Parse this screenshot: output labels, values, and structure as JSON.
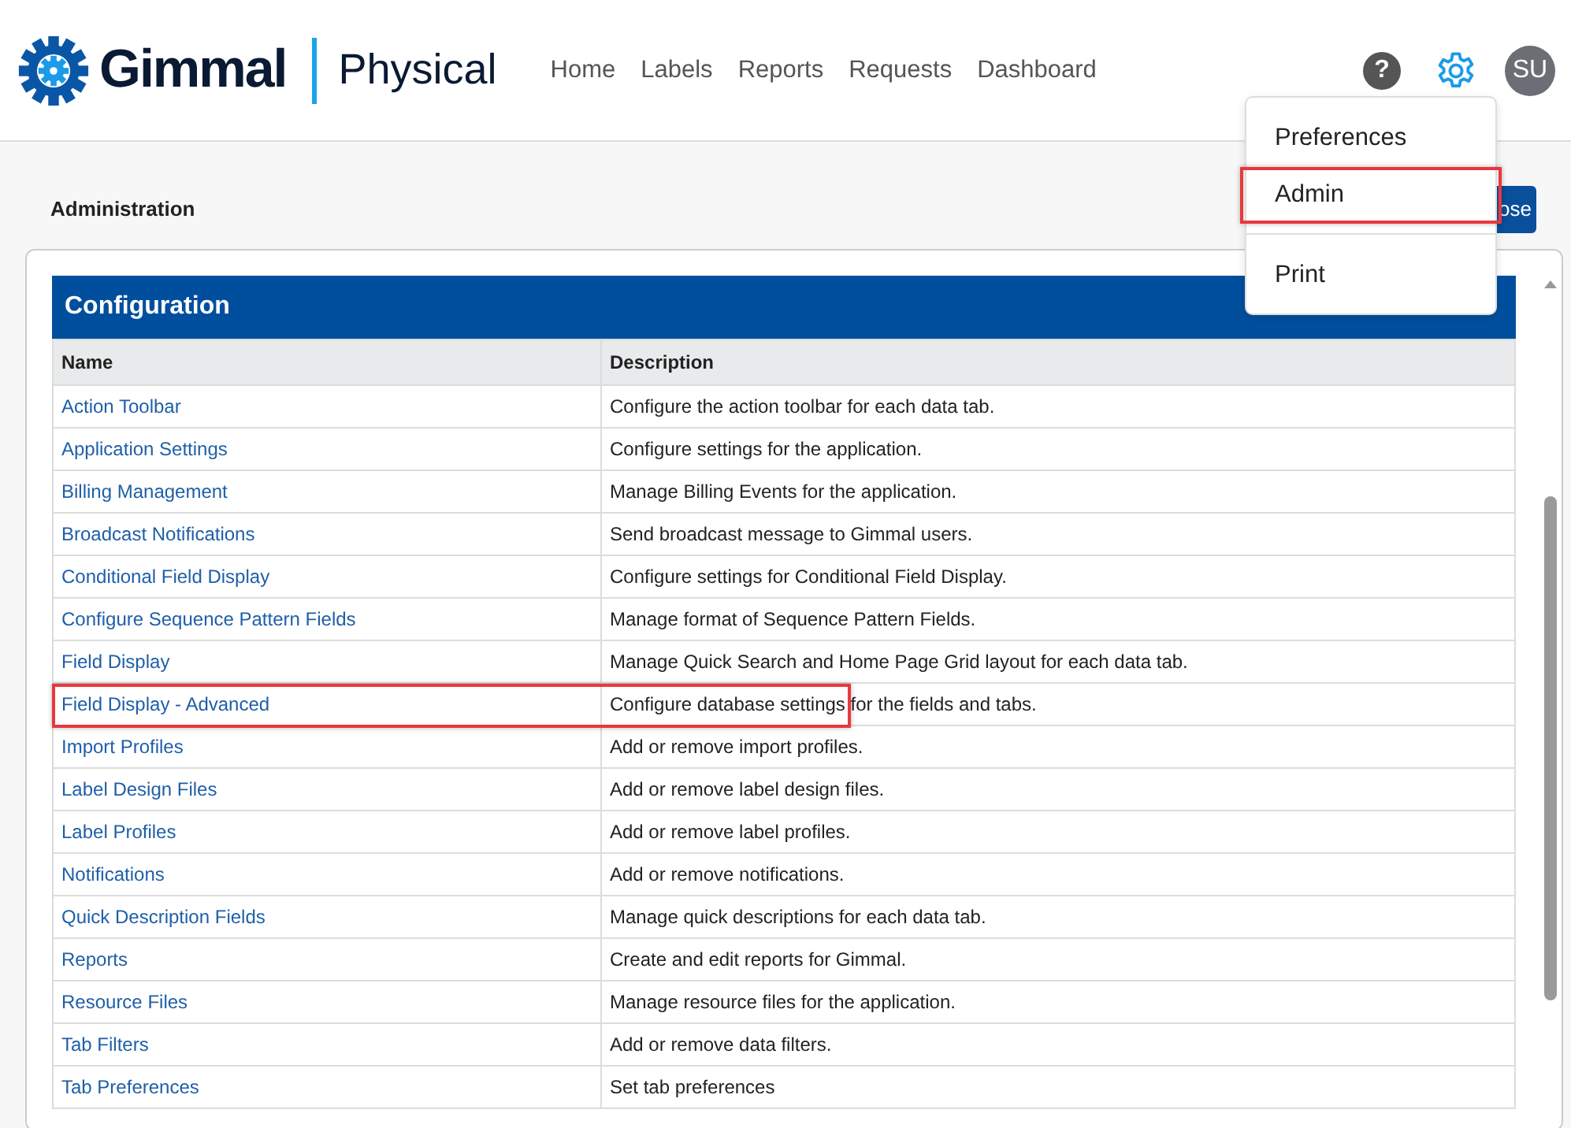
{
  "header": {
    "brand": "Gimmal",
    "product": "Physical",
    "nav": [
      {
        "label": "Home"
      },
      {
        "label": "Labels"
      },
      {
        "label": "Reports"
      },
      {
        "label": "Requests"
      },
      {
        "label": "Dashboard"
      }
    ],
    "help": "?",
    "avatar": "SU"
  },
  "menu": [
    {
      "label": "Preferences",
      "highlighted": false,
      "divider_after": false
    },
    {
      "label": "Admin",
      "highlighted": true,
      "divider_after": true
    },
    {
      "label": "Print",
      "highlighted": false,
      "divider_after": false
    }
  ],
  "page": {
    "title": "Administration",
    "close_button": "ose"
  },
  "table": {
    "title": "Configuration",
    "columns": [
      "Name",
      "Description"
    ],
    "rows": [
      {
        "name": "Action Toolbar",
        "description": "Configure the action toolbar for each data tab.",
        "highlighted": false
      },
      {
        "name": "Application Settings",
        "description": "Configure settings for the application.",
        "highlighted": false
      },
      {
        "name": "Billing Management",
        "description": "Manage Billing Events for the application.",
        "highlighted": false
      },
      {
        "name": "Broadcast Notifications",
        "description": "Send broadcast message to Gimmal users.",
        "highlighted": false
      },
      {
        "name": "Conditional Field Display",
        "description": "Configure settings for Conditional Field Display.",
        "highlighted": false
      },
      {
        "name": "Configure Sequence Pattern Fields",
        "description": "Manage format of Sequence Pattern Fields.",
        "highlighted": false
      },
      {
        "name": "Field Display",
        "description": "Manage Quick Search and Home Page Grid layout for each data tab.",
        "highlighted": false
      },
      {
        "name": "Field Display - Advanced",
        "description": "Configure database settings for the fields and tabs.",
        "highlighted": true
      },
      {
        "name": "Import Profiles",
        "description": "Add or remove import profiles.",
        "highlighted": false
      },
      {
        "name": "Label Design Files",
        "description": "Add or remove label design files.",
        "highlighted": false
      },
      {
        "name": "Label Profiles",
        "description": "Add or remove label profiles.",
        "highlighted": false
      },
      {
        "name": "Notifications",
        "description": "Add or remove notifications.",
        "highlighted": false
      },
      {
        "name": "Quick Description Fields",
        "description": "Manage quick descriptions for each data tab.",
        "highlighted": false
      },
      {
        "name": "Reports",
        "description": "Create and edit reports for Gimmal.",
        "highlighted": false
      },
      {
        "name": "Resource Files",
        "description": "Manage resource files for the application.",
        "highlighted": false
      },
      {
        "name": "Tab Filters",
        "description": "Add or remove data filters.",
        "highlighted": false
      },
      {
        "name": "Tab Preferences",
        "description": "Set tab preferences",
        "highlighted": false
      }
    ]
  }
}
